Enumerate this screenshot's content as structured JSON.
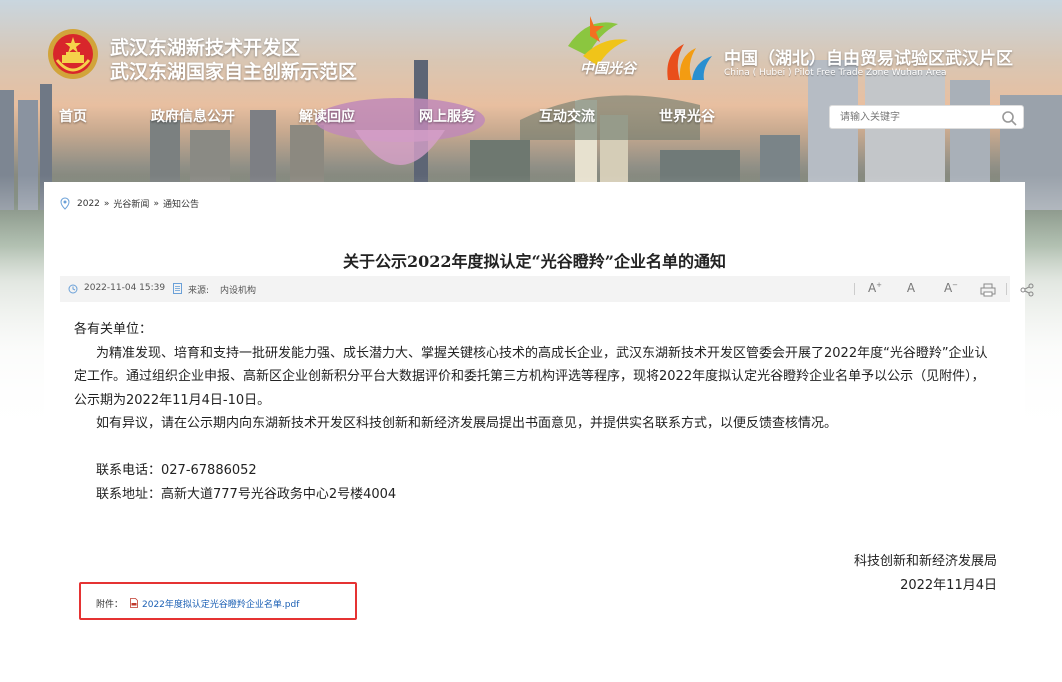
{
  "header": {
    "title_line1": "武汉东湖新技术开发区",
    "title_line2": "武汉东湖国家自主创新示范区",
    "optics_valley_logo_text": "中国光谷",
    "ftz_title": "中国（湖北）自由贸易试验区武汉片区",
    "ftz_subtitle": "China ( Hubei ) Pilot Free Trade Zone Wuhan Area"
  },
  "nav": {
    "items": [
      {
        "label": "首页"
      },
      {
        "label": "政府信息公开"
      },
      {
        "label": "解读回应"
      },
      {
        "label": "网上服务"
      },
      {
        "label": "互动交流"
      },
      {
        "label": "世界光谷"
      }
    ]
  },
  "search": {
    "placeholder": "请输入关键字",
    "icon": "search-icon"
  },
  "breadcrumb": {
    "items": [
      "2022",
      "光谷新闻",
      "通知公告"
    ],
    "separator": "»"
  },
  "article": {
    "title": "关于公示2022年度拟认定“光谷瞪羚”企业名单的通知",
    "date": "2022-11-04 15:39",
    "source_label": "来源:",
    "source": "内设机构",
    "tools": [
      "A+",
      "A",
      "A-",
      "print",
      "share"
    ],
    "salutation": "各有关单位：",
    "paragraph1": "为精准发现、培育和支持一批研发能力强、成长潜力大、掌握关键核心技术的高成长企业，武汉东湖新技术开发区管委会开展了2022年度“光谷瞪羚”企业认定工作。通过组织企业申报、高新区企业创新积分平台大数据评价和委托第三方机构评选等程序，现将2022年度拟认定光谷瞪羚企业名单予以公示（见附件），公示期为2022年11月4日-10日。",
    "paragraph2": "如有异议，请在公示期内向东湖新技术开发区科技创新和新经济发展局提出书面意见，并提供实名联系方式，以便反馈查核情况。",
    "phone": "联系电话：027-67886052",
    "address": "联系地址：高新大道777号光谷政务中心2号楼4004",
    "signature_org": "科技创新和新经济发展局",
    "signature_date": "2022年11月4日",
    "attachment_label": "附件：",
    "attachment_name": "2022年度拟认定光谷瞪羚企业名单.pdf"
  },
  "colors": {
    "attachment_border": "#e53333",
    "link": "#1a5fb4",
    "meta_bar_bg": "#f3f3f3"
  }
}
